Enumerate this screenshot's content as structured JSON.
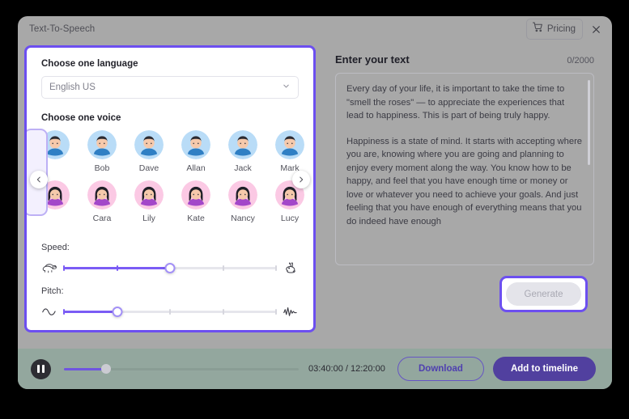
{
  "titlebar": {
    "title": "Text-To-Speech",
    "pricing_label": "Pricing",
    "pricing_icon": "shopping-cart-icon",
    "close_icon": "close-icon"
  },
  "left_panel": {
    "language_label": "Choose one language",
    "language_value": "English US",
    "language_caret_icon": "chevron-down-icon",
    "voice_label": "Choose one voice",
    "prev_icon": "chevron-left-icon",
    "next_icon": "chevron-right-icon",
    "voices_row1": [
      "Bob",
      "Dave",
      "Allan",
      "Jack",
      "Mark"
    ],
    "voices_row2": [
      "Cara",
      "Lily",
      "Kate",
      "Nancy",
      "Lucy"
    ],
    "speed": {
      "caption": "Speed:",
      "left_icon": "turtle-icon",
      "right_icon": "rabbit-icon",
      "value_percent": 50,
      "ticks_percent": [
        0,
        25,
        50,
        75,
        100
      ]
    },
    "pitch": {
      "caption": "Pitch:",
      "left_icon": "smooth-wave-icon",
      "right_icon": "jagged-waveform-icon",
      "value_percent": 25,
      "ticks_percent": [
        0,
        25,
        50,
        75,
        100
      ]
    }
  },
  "right_panel": {
    "title": "Enter your text",
    "char_count": "0/2000",
    "paragraph_1": "Every day of your life, it is important to take the time to \"smell the roses\" — to appreciate the experiences that lead to happiness. This is part of being truly happy.",
    "paragraph_2": "Happiness is a state of mind. It starts with accepting where you are, knowing where you are going and planning to enjoy every moment along the way. You know how to be happy, and feel that you have enough time or money or love or whatever you need to achieve your goals. And just feeling that you have enough of everything means that you do indeed have enough",
    "generate_label": "Generate"
  },
  "footer": {
    "play_icon": "pause-icon",
    "progress_percent": 18,
    "time_display": "03:40:00 / 12:20:00",
    "download_label": "Download",
    "add_timeline_label": "Add to timeline"
  },
  "colors": {
    "accent": "#6c4ff0",
    "accent_deep": "#51409f",
    "footer_bg": "#93a79e",
    "modal_bg": "#a8a8a8"
  }
}
